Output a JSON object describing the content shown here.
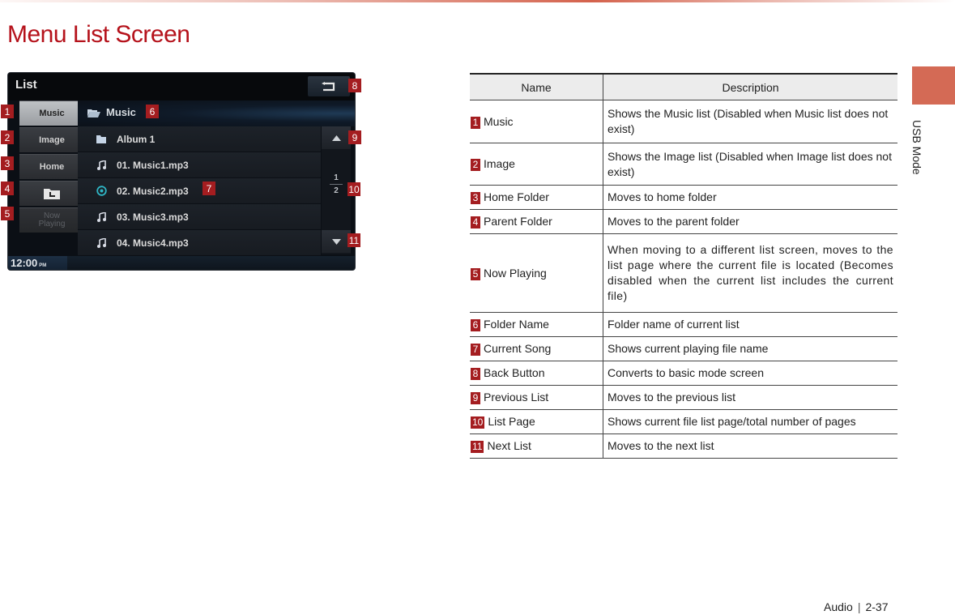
{
  "page": {
    "title": "Menu List Screen",
    "side_tab_label": "USB Mode",
    "footer": {
      "section": "Audio",
      "page_number": "2-37"
    }
  },
  "screen": {
    "title": "List",
    "side_menu": [
      {
        "label": "Music",
        "callout": "1",
        "state": "active"
      },
      {
        "label": "Image",
        "callout": "2",
        "state": "normal"
      },
      {
        "label": "Home",
        "callout": "3",
        "state": "normal"
      },
      {
        "label": "",
        "icon": "parent-folder-icon",
        "callout": "4",
        "state": "normal"
      },
      {
        "label": "Now Playing",
        "callout": "5",
        "state": "disabled"
      }
    ],
    "folder": {
      "name": "Music",
      "callout": "6"
    },
    "list_items": [
      {
        "label": "Album 1",
        "icon": "folder-icon"
      },
      {
        "label": "01. Music1.mp3",
        "icon": "music-note-icon"
      },
      {
        "label": "02. Music2.mp3",
        "icon": "now-playing-icon",
        "callout": "7"
      },
      {
        "label": "03. Music3.mp3",
        "icon": "music-note-icon"
      },
      {
        "label": "04. Music4.mp3",
        "icon": "music-note-icon"
      }
    ],
    "back_callout": "8",
    "prev_callout": "9",
    "page_indicator": {
      "current": "1",
      "total": "2",
      "callout": "10"
    },
    "next_callout": "11",
    "clock": {
      "time": "12:00",
      "ampm": "PM"
    },
    "colors": {
      "now_playing_accent": "#2fb6c6",
      "callout_badge": "#a41d20"
    }
  },
  "table": {
    "headers": {
      "name": "Name",
      "description": "Description"
    },
    "rows": [
      {
        "num": "1",
        "name": "Music",
        "description": "Shows the Music list (Disabled when Music list does not exist)"
      },
      {
        "num": "2",
        "name": "Image",
        "description": "Shows the Image list (Disabled when Image list does not exist)"
      },
      {
        "num": "3",
        "name": "Home Folder",
        "description": "Moves to home folder"
      },
      {
        "num": "4",
        "name": "Parent Folder",
        "description": "Moves to the parent folder"
      },
      {
        "num": "5",
        "name": "Now Playing",
        "description": "When moving to a different list screen, moves to the list page where the current file is located (Becomes disabled when the current list includes the current file)"
      },
      {
        "num": "6",
        "name": "Folder Name",
        "description": "Folder name of current list"
      },
      {
        "num": "7",
        "name": "Current Song",
        "description": "Shows current playing file name"
      },
      {
        "num": "8",
        "name": "Back Button",
        "description": "Converts to basic mode screen"
      },
      {
        "num": "9",
        "name": "Previous List",
        "description": "Moves to the previous list"
      },
      {
        "num": "10",
        "name": "List Page",
        "description": "Shows current file list page/total number of pages"
      },
      {
        "num": "11",
        "name": "Next List",
        "description": "Moves to the next list"
      }
    ]
  }
}
